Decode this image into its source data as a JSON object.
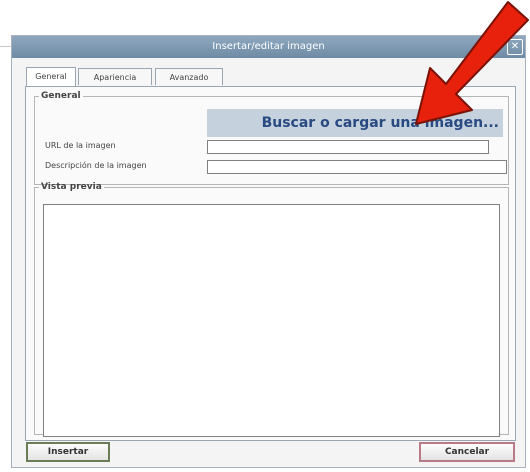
{
  "dialog": {
    "title": "Insertar/editar imagen",
    "close_icon": "close-icon"
  },
  "tabs": [
    {
      "label": "General",
      "active": true
    },
    {
      "label": "Apariencia",
      "active": false
    },
    {
      "label": "Avanzado",
      "active": false
    }
  ],
  "general": {
    "legend": "General",
    "search_link": "Buscar o cargar una imagen...",
    "url_label": "URL de la imagen",
    "url_value": "",
    "description_label": "Descripción de la imagen",
    "description_value": ""
  },
  "preview": {
    "legend": "Vista previa"
  },
  "buttons": {
    "insert": "Insertar",
    "cancel": "Cancelar"
  },
  "annotation": {
    "arrow_icon": "red-arrow-icon",
    "arrow_color": "#e8210c"
  }
}
